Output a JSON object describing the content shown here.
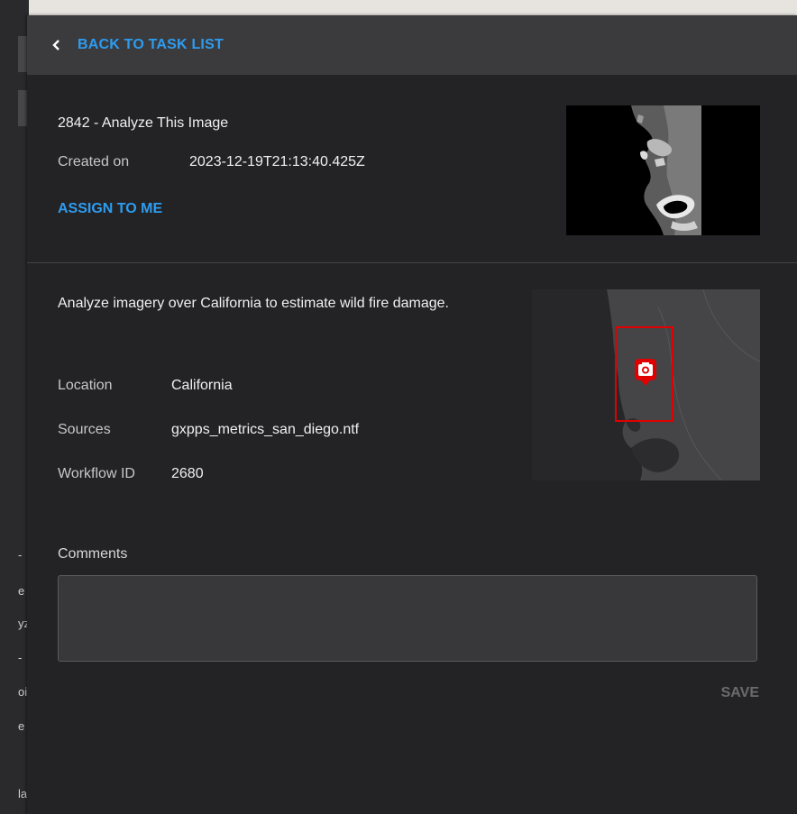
{
  "header": {
    "back_label": "BACK TO TASK LIST"
  },
  "task": {
    "title": "2842 - Analyze This Image",
    "created_label": "Created on",
    "created_value": "2023-12-19T21:13:40.425Z",
    "assign_label": "ASSIGN TO ME",
    "description": "Analyze imagery over California to estimate wild fire damage."
  },
  "meta": {
    "location_label": "Location",
    "location_value": "California",
    "sources_label": "Sources",
    "sources_value": "gxpps_metrics_san_diego.ntf",
    "workflow_label": "Workflow ID",
    "workflow_value": "2680"
  },
  "comments": {
    "label": "Comments",
    "value": ""
  },
  "actions": {
    "save_label": "SAVE"
  },
  "colors": {
    "accent": "#2d9cf0",
    "footprint": "#e00000",
    "panel": "#232325"
  },
  "icons": {
    "back": "chevron-left-icon",
    "marker": "camera-icon"
  },
  "background": {
    "glyphs": [
      "-",
      "e",
      "yz",
      "-",
      "oi",
      "e",
      "la"
    ]
  }
}
